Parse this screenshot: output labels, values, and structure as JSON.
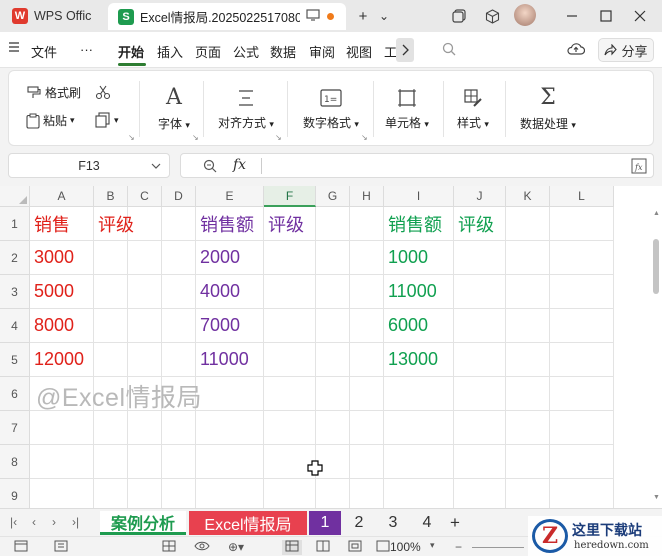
{
  "titlebar": {
    "app_tab": "WPS Offic",
    "doc_tab": "Excel情报局.2025022517080",
    "new_tab": "+",
    "dropdown": "⌄"
  },
  "menubar": {
    "file": "文件",
    "more": "···",
    "items": [
      "开始",
      "插入",
      "页面",
      "公式",
      "数据",
      "审阅",
      "视图",
      "工"
    ],
    "share": "分享"
  },
  "ribbon": {
    "format_painter": "格式刷",
    "paste": "粘贴",
    "font": "字体",
    "align": "对齐方式",
    "number_format": "数字格式",
    "cell": "单元格",
    "style": "样式",
    "data_process": "数据处理"
  },
  "formula": {
    "name_box": "F13",
    "fx": "fx",
    "value": ""
  },
  "grid": {
    "columns": [
      "A",
      "B",
      "C",
      "D",
      "E",
      "F",
      "G",
      "H",
      "I",
      "J",
      "K",
      "L"
    ],
    "selected_column": "F",
    "rows": [
      "1",
      "2",
      "3",
      "4",
      "5",
      "6",
      "7",
      "8",
      "9"
    ],
    "header_row": {
      "A": "销售",
      "B": "评级",
      "E": "销售额",
      "F": "评级",
      "I": "销售额",
      "J": "评级"
    },
    "col_A": [
      "3000",
      "5000",
      "8000",
      "12000"
    ],
    "col_E": [
      "2000",
      "4000",
      "7000",
      "11000"
    ],
    "col_I": [
      "1000",
      "11000",
      "6000",
      "13000"
    ],
    "watermark": "@Excel情报局",
    "colors": {
      "red": "#e0211a",
      "purple": "#7030a0",
      "green": "#10a050"
    }
  },
  "sheets": {
    "tabs": [
      "案例分析",
      "Excel情报局",
      "1",
      "2",
      "3",
      "4"
    ],
    "add": "+"
  },
  "status": {
    "zoom": "100%"
  },
  "brand": {
    "logo": "Z",
    "cn": "这里下载站",
    "en": "heredown.com"
  }
}
